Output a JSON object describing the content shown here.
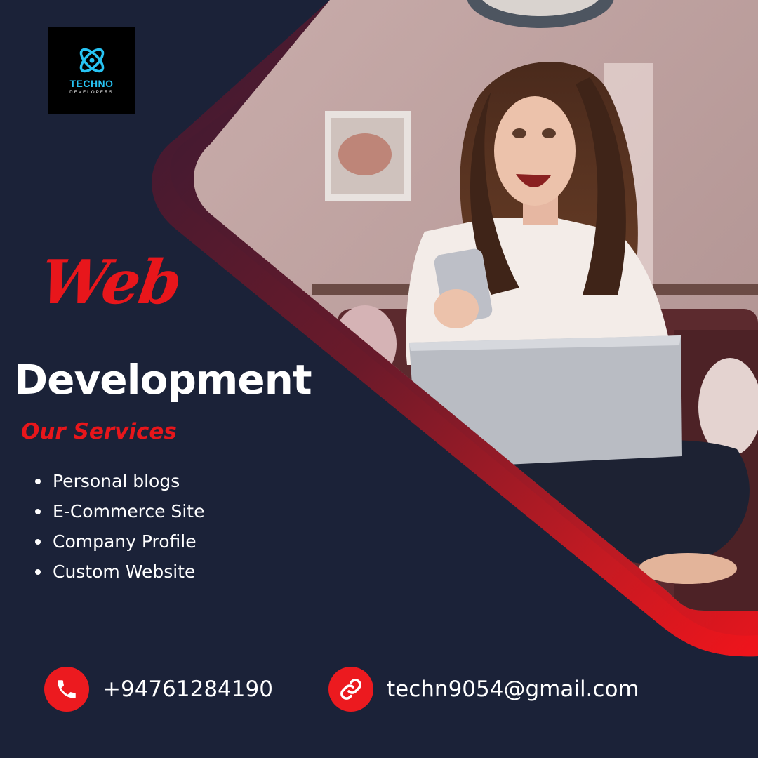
{
  "brand": {
    "name": "TECHNO",
    "tagline": "DEVELOPERS",
    "accent_color": "#27c3f3"
  },
  "headline": {
    "script_word": "Web",
    "main_word": "Development"
  },
  "services": {
    "heading": "Our Services",
    "items": [
      {
        "label": "Personal blogs"
      },
      {
        "label": "E-Commerce Site"
      },
      {
        "label": "Company Profile"
      },
      {
        "label": "Custom Website"
      }
    ]
  },
  "contact": {
    "phone": {
      "icon": "phone-icon",
      "value": "+94761284190"
    },
    "email": {
      "icon": "link-icon",
      "value": "techn9054@gmail.com"
    }
  },
  "colors": {
    "background": "#1b2238",
    "accent_red": "#e8161b",
    "text": "#ffffff"
  },
  "photo": {
    "subject": "woman-with-phone-and-laptop-photo"
  }
}
